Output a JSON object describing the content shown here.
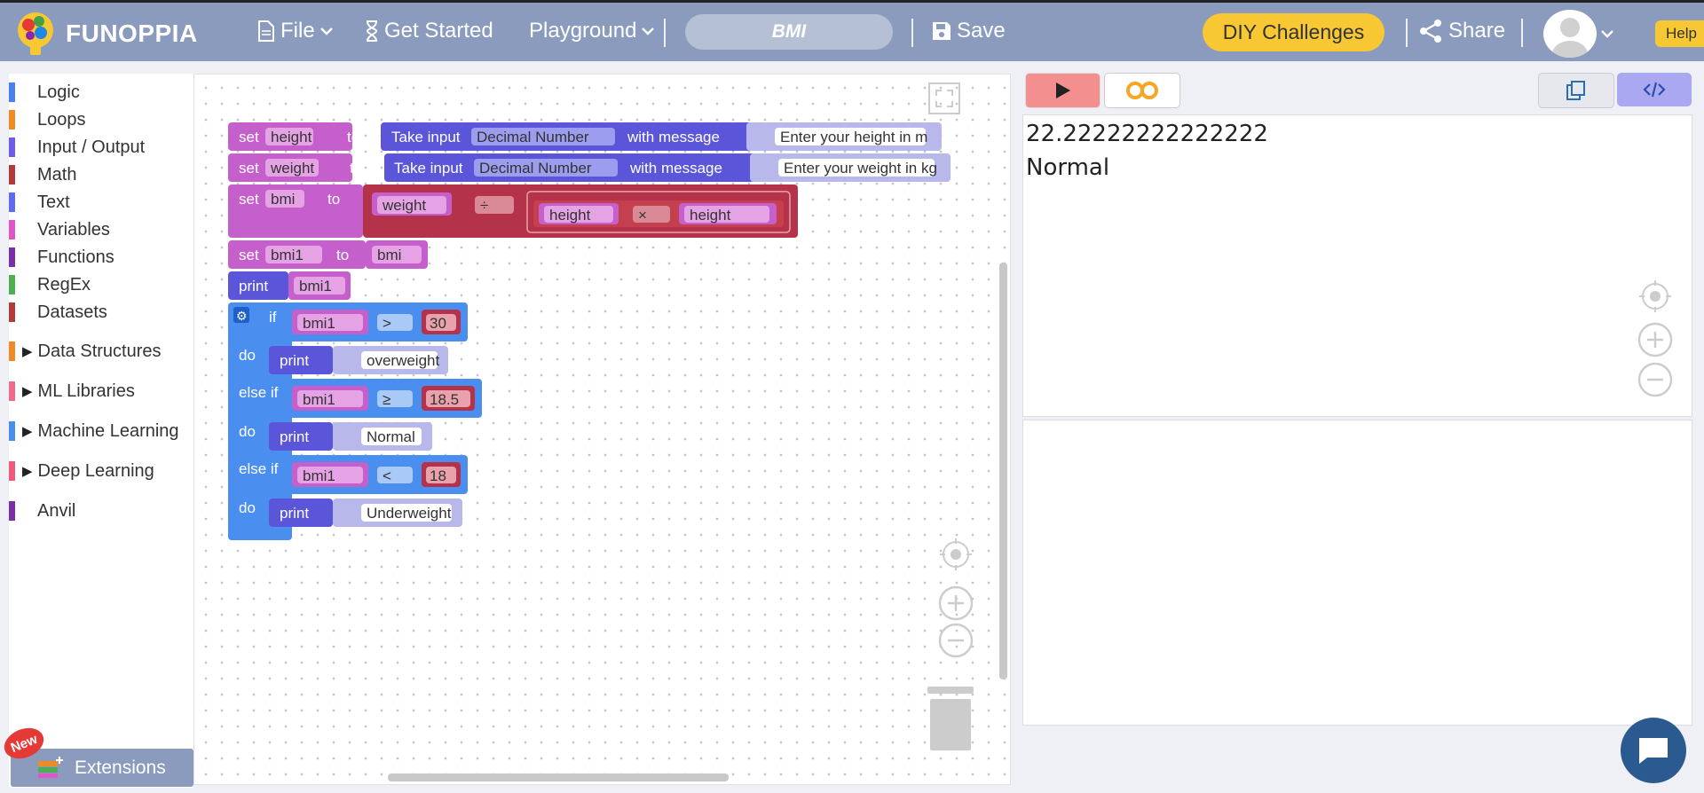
{
  "app": {
    "brand": "FUNOPPIA",
    "project_name": "BMI"
  },
  "topbar": {
    "file": "File",
    "get_started": "Get Started",
    "playground": "Playground",
    "save": "Save",
    "diy": "DIY Challenges",
    "share": "Share",
    "help": "Help"
  },
  "sidebar": {
    "categories": [
      {
        "label": "Logic",
        "color": "#4a7ff0"
      },
      {
        "label": "Loops",
        "color": "#f08a24"
      },
      {
        "label": "Input / Output",
        "color": "#6c5ce7"
      },
      {
        "label": "Math",
        "color": "#b23a3a"
      },
      {
        "label": "Text",
        "color": "#5c6bf0"
      },
      {
        "label": "Variables",
        "color": "#e056c8"
      },
      {
        "label": "Functions",
        "color": "#7b2ea8"
      },
      {
        "label": "RegEx",
        "color": "#4caf50"
      },
      {
        "label": "Datasets",
        "color": "#b23a3a"
      }
    ],
    "groups": [
      {
        "label": "Data Structures",
        "color": "#f08a24"
      },
      {
        "label": "ML Libraries",
        "color": "#f06a8a"
      },
      {
        "label": "Machine Learning",
        "color": "#4a8ff0"
      },
      {
        "label": "Deep Learning",
        "color": "#f05a7a"
      }
    ],
    "anvil": {
      "label": "Anvil",
      "color": "#7b2ea8"
    },
    "extensions": "Extensions",
    "new_badge": "New"
  },
  "blocks": {
    "set": "set",
    "to": "to",
    "take_input": "Take input",
    "decimal_number": "Decimal Number",
    "with_message": "with message",
    "var_height": "height",
    "var_weight": "weight",
    "var_bmi": "bmi",
    "var_bmi1": "bmi1",
    "msg_height": "Enter your height in m",
    "msg_weight": "Enter your weight in kg",
    "op_div": "÷",
    "op_mul": "×",
    "print": "print",
    "if": "if",
    "else_if": "else if",
    "do": "do",
    "op_gt": ">",
    "op_ge": "≥",
    "op_lt": "<",
    "num_30": "30",
    "num_18_5": "18.5",
    "num_18": "18",
    "txt_over": "overweight",
    "txt_normal": "Normal",
    "txt_under": "Underweight"
  },
  "console": {
    "lines": [
      "22.22222222222222",
      "Normal"
    ]
  },
  "colors": {
    "topbar": "#8a9bbd",
    "variables": "#c55fcb",
    "input": "#5b56d9",
    "math": "#b5334a",
    "logic": "#4a8ff0",
    "text": "#b8b8ea",
    "diy": "#f7c734"
  }
}
